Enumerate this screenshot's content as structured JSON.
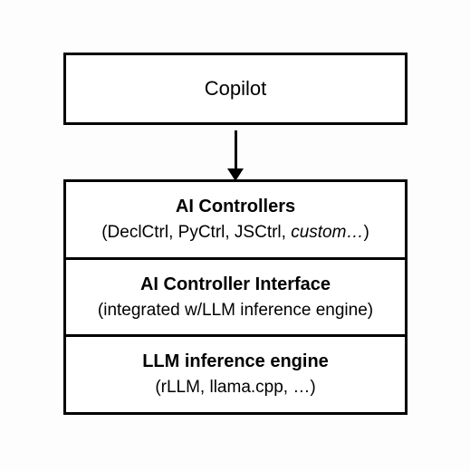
{
  "diagram": {
    "top": {
      "label": "Copilot"
    },
    "stack": [
      {
        "title": "AI Controllers",
        "sub_prefix": "(DeclCtrl, PyCtrl, JSCtrl, ",
        "sub_italic": "custom…",
        "sub_suffix": ")"
      },
      {
        "title": "AI Controller Interface",
        "sub": "(integrated w/LLM inference engine)"
      },
      {
        "title": "LLM inference engine",
        "sub": "(rLLM, llama.cpp, …)"
      }
    ]
  }
}
